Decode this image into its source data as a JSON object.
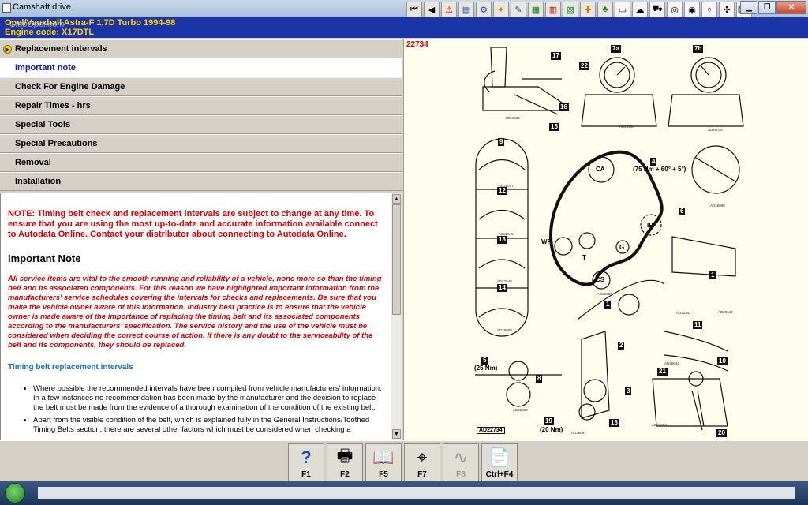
{
  "window": {
    "title": "Camshaft drive"
  },
  "vehicle": {
    "line1": "Opel/Vauxhall   Astra-F   1,7D Turbo 1994-98",
    "line2": "Engine code: X17DTL",
    "watermark": "ClubOpel.com"
  },
  "nav": {
    "items": [
      {
        "label": "Replacement intervals",
        "marker": true
      },
      {
        "label": "Important note",
        "active": true
      },
      {
        "label": "Check For Engine Damage"
      },
      {
        "label": "Repair Times - hrs"
      },
      {
        "label": "Special Tools"
      },
      {
        "label": "Special Precautions"
      },
      {
        "label": "Removal"
      },
      {
        "label": "Installation"
      }
    ]
  },
  "content": {
    "note": "NOTE: Timing belt check and replacement intervals are subject to change at any time. To ensure that you are using the most up-to-date and accurate information available connect to Autodata Online. Contact your distributor about connecting to Autodata Online.",
    "heading": "Important Note",
    "paragraph": "All service items are vital to the smooth running and reliability of a vehicle, none more so than the timing belt and its associated components. For this reason we have highlighted important information from the manufacturers' service schedules covering the intervals for checks and replacements. Be sure that you make the vehicle owner aware of this information. Industry best practice is to ensure that the vehicle owner is made aware of the importance of replacing the timing belt and its associated components according to the manufacturers' specification. The service history and the use of the vehicle must be considered when deciding the correct course of action. If there is any doubt to the serviceability of the belt and its components, they should be replaced.",
    "subheading": "Timing belt replacement intervals",
    "bullets": [
      "Where possible the recommended intervals have been compiled from vehicle manufacturers' information. In a few instances no recommendation has been made by the manufacturer and the decision to replace the belt must be made from the evidence of a thorough examination of the condition of the existing belt.",
      "Apart from the visible condition of the belt, which is explained fully in the General Instructions/Toothed Timing Belts section, there are several other factors which must be considered when checking a"
    ]
  },
  "diagram": {
    "ref": "22734",
    "labels": {
      "n17": "17",
      "n16": "16",
      "n15": "15",
      "n22": "22",
      "n7a": "7a",
      "n7b": "7b",
      "n9": "9",
      "n12": "12",
      "n13": "13",
      "n14": "14",
      "n4": "4",
      "n6": "6",
      "n1a": "1",
      "n1b": "1",
      "n2": "2",
      "n3": "3",
      "n5": "5",
      "n8": "8",
      "n19": "19",
      "n18": "18",
      "n11": "11",
      "n10": "10",
      "n21": "21",
      "n20": "20"
    },
    "torque4": "(75 Nm + 60° + 5°)",
    "torque5": "(25 Nm)",
    "torque19": "(20 Nm)",
    "ca": "CA",
    "ip": "IP",
    "wp": "WP",
    "g": "G",
    "cs": "CS",
    "t": "T",
    "fig_id": "AD22734",
    "codes": [
      "AD26633",
      "AD26034",
      "AD26036",
      "AD26037",
      "AD22545",
      "AD22548",
      "AD26880",
      "AD26080",
      "AD26090",
      "AD22541",
      "AD26642",
      "AD26609",
      "AD26091",
      "AD27693",
      "AD28642"
    ]
  },
  "fkeys": [
    {
      "label": "F1",
      "icon": "help-icon",
      "glyph": "?"
    },
    {
      "label": "F2",
      "icon": "printer-icon",
      "glyph": "🖶"
    },
    {
      "label": "F5",
      "icon": "book-icon",
      "glyph": "📖"
    },
    {
      "label": "F7",
      "icon": "magnifier-icon",
      "glyph": "⌖"
    },
    {
      "label": "F8",
      "icon": "belt-icon",
      "glyph": "∿",
      "disabled": true
    },
    {
      "label": "Ctrl+F4",
      "icon": "document-icon",
      "glyph": "📄"
    }
  ],
  "colors": {
    "header": "#1b35a8",
    "header_text": "#ffd200",
    "note_red": "#e00000",
    "link_blue": "#1c6ec9",
    "active_nav": "#1414b8"
  }
}
